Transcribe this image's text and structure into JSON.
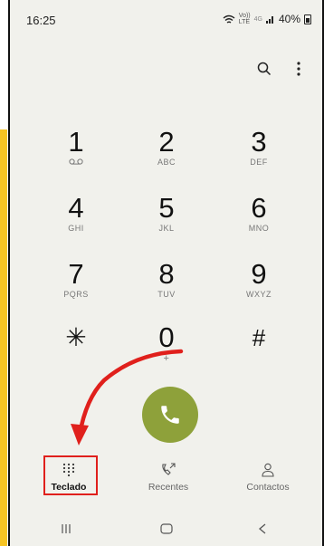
{
  "status_bar": {
    "time": "16:25",
    "lte_label": "LTE",
    "volte_label": "Vo))",
    "network_label": "4G",
    "battery_percent": "40%"
  },
  "top_actions": {
    "search_icon": "search-icon",
    "more_icon": "more-vert-icon"
  },
  "keypad": {
    "keys": [
      {
        "digit": "1",
        "letters": "QO"
      },
      {
        "digit": "2",
        "letters": "ABC"
      },
      {
        "digit": "3",
        "letters": "DEF"
      },
      {
        "digit": "4",
        "letters": "GHI"
      },
      {
        "digit": "5",
        "letters": "JKL"
      },
      {
        "digit": "6",
        "letters": "MNO"
      },
      {
        "digit": "7",
        "letters": "PQRS"
      },
      {
        "digit": "8",
        "letters": "TUV"
      },
      {
        "digit": "9",
        "letters": "WXYZ"
      },
      {
        "digit": "✳",
        "letters": ""
      },
      {
        "digit": "0",
        "letters": "+"
      },
      {
        "digit": "#",
        "letters": ""
      }
    ]
  },
  "call_button": {
    "icon": "phone-icon"
  },
  "tabs": [
    {
      "label": "Teclado",
      "icon": "dialpad-icon",
      "active": true
    },
    {
      "label": "Recentes",
      "icon": "recent-calls-icon",
      "active": false
    },
    {
      "label": "Contactos",
      "icon": "person-icon",
      "active": false
    }
  ],
  "nav_bar": {
    "recents_icon": "recent-apps-icon",
    "home_icon": "home-icon",
    "back_icon": "back-icon"
  },
  "colors": {
    "call_green": "#8ea13a",
    "highlight_red": "#e0201c",
    "side_yellow": "#f6c423",
    "background": "#f1f1ec"
  }
}
